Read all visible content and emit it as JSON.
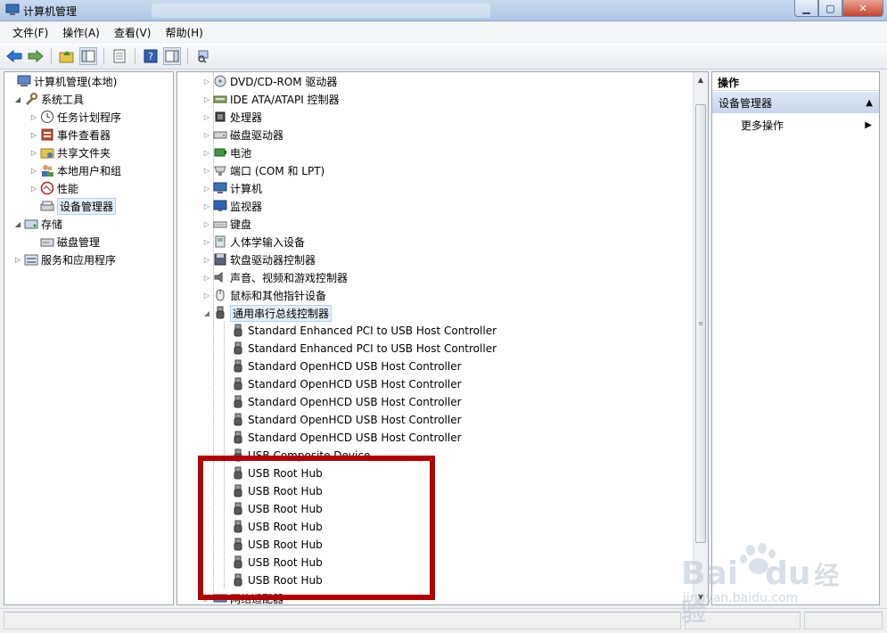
{
  "window": {
    "title": "计算机管理"
  },
  "menu": [
    {
      "label": "文件(F)"
    },
    {
      "label": "操作(A)"
    },
    {
      "label": "查看(V)"
    },
    {
      "label": "帮助(H)"
    }
  ],
  "left_tree": {
    "root": "计算机管理(本地)",
    "items": [
      {
        "label": "系统工具"
      },
      {
        "label": "任务计划程序"
      },
      {
        "label": "事件查看器"
      },
      {
        "label": "共享文件夹"
      },
      {
        "label": "本地用户和组"
      },
      {
        "label": "性能"
      },
      {
        "label": "设备管理器"
      },
      {
        "label": "存储"
      },
      {
        "label": "磁盘管理"
      },
      {
        "label": "服务和应用程序"
      }
    ]
  },
  "device_tree": {
    "categories": [
      {
        "label": "DVD/CD-ROM 驱动器"
      },
      {
        "label": "IDE ATA/ATAPI 控制器"
      },
      {
        "label": "处理器"
      },
      {
        "label": "磁盘驱动器"
      },
      {
        "label": "电池"
      },
      {
        "label": "端口 (COM 和 LPT)"
      },
      {
        "label": "计算机"
      },
      {
        "label": "监视器"
      },
      {
        "label": "键盘"
      },
      {
        "label": "人体学输入设备"
      },
      {
        "label": "软盘驱动器控制器"
      },
      {
        "label": "声音、视频和游戏控制器"
      },
      {
        "label": "鼠标和其他指针设备"
      },
      {
        "label": "通用串行总线控制器"
      }
    ],
    "usb_devices": [
      {
        "label": "Standard Enhanced PCI to USB Host Controller"
      },
      {
        "label": "Standard Enhanced PCI to USB Host Controller"
      },
      {
        "label": "Standard OpenHCD USB Host Controller"
      },
      {
        "label": "Standard OpenHCD USB Host Controller"
      },
      {
        "label": "Standard OpenHCD USB Host Controller"
      },
      {
        "label": "Standard OpenHCD USB Host Controller"
      },
      {
        "label": "Standard OpenHCD USB Host Controller"
      },
      {
        "label": "USB Composite Device"
      },
      {
        "label": "USB Root Hub"
      },
      {
        "label": "USB Root Hub"
      },
      {
        "label": "USB Root Hub"
      },
      {
        "label": "USB Root Hub"
      },
      {
        "label": "USB Root Hub"
      },
      {
        "label": "USB Root Hub"
      },
      {
        "label": "USB Root Hub"
      }
    ],
    "last_category": {
      "label": "网络适配器"
    }
  },
  "actions": {
    "header": "操作",
    "section": "设备管理器",
    "more": "更多操作"
  },
  "watermark": {
    "brand": "Bai",
    "brand2": "du",
    "brand_cn": "经验",
    "site": "jingyan.baidu.com"
  },
  "colors": {
    "highlight": "#b40000",
    "selection": "#e5eef9"
  }
}
